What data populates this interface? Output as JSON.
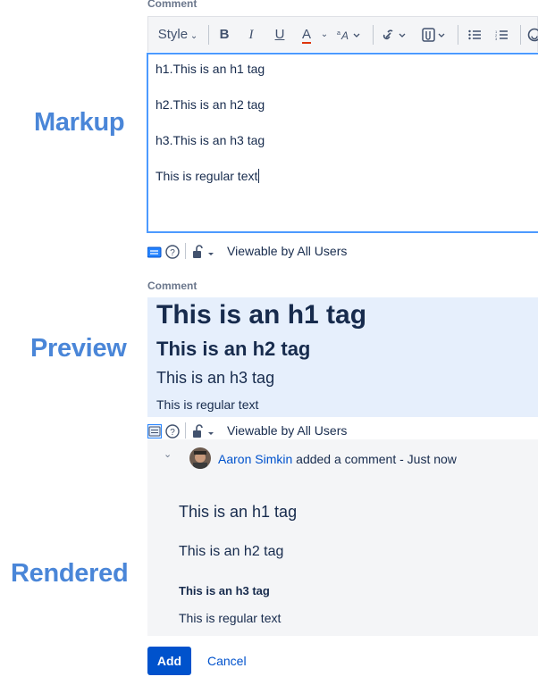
{
  "side_labels": {
    "markup": "Markup",
    "preview": "Preview",
    "rendered": "Rendered"
  },
  "editor": {
    "label": "Comment",
    "toolbar": {
      "style": "Style",
      "bold": "B",
      "italic": "I",
      "underline": "U",
      "text_color": "A",
      "text_color_accent": "#de350b"
    },
    "lines": [
      "h1.This is an h1 tag",
      "h2.This is an h2 tag",
      "h3.This is an h3 tag",
      "This is regular text"
    ],
    "footer": {
      "visibility": "Viewable by All Users"
    }
  },
  "preview": {
    "label": "Comment",
    "h1": "This is an h1 tag",
    "h2": "This is an h2 tag",
    "h3": "This is an h3 tag",
    "text": "This is regular text",
    "footer": {
      "visibility": "Viewable by All Users"
    }
  },
  "rendered": {
    "author": "Aaron Simkin",
    "action": "added a comment - Just now",
    "h1": "This is an h1 tag",
    "h2": "This is an h2 tag",
    "h3": "This is an h3 tag",
    "text": "This is regular text"
  },
  "actions": {
    "add": "Add",
    "cancel": "Cancel"
  },
  "colors": {
    "label_blue": "#4a86d8",
    "link": "#0052cc",
    "focus": "#4c9aff",
    "preview_bg": "#e6effc"
  }
}
